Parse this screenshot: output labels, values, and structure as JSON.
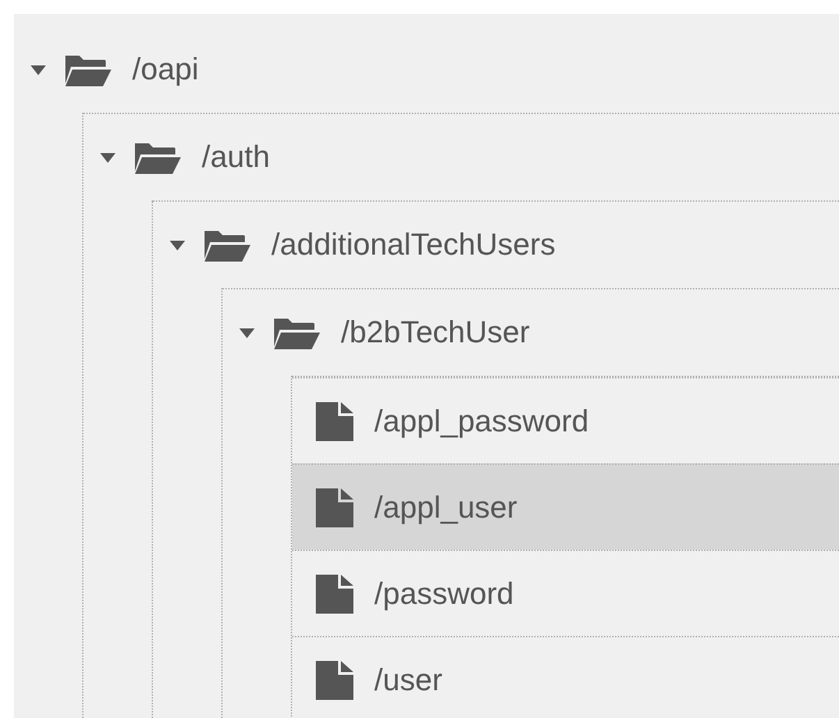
{
  "tree": [
    {
      "kind": "folder",
      "label": "/oapi",
      "expanded": true,
      "selected": false,
      "children": [
        {
          "kind": "folder",
          "label": "/auth",
          "expanded": true,
          "selected": false,
          "children": [
            {
              "kind": "folder",
              "label": "/additionalTechUsers",
              "expanded": true,
              "selected": false,
              "children": [
                {
                  "kind": "folder",
                  "label": "/b2bTechUser",
                  "expanded": true,
                  "selected": false,
                  "children": [
                    {
                      "kind": "file",
                      "label": "/appl_password",
                      "selected": false
                    },
                    {
                      "kind": "file",
                      "label": "/appl_user",
                      "selected": true
                    },
                    {
                      "kind": "file",
                      "label": "/password",
                      "selected": false
                    },
                    {
                      "kind": "file",
                      "label": "/user",
                      "selected": false
                    }
                  ]
                }
              ]
            }
          ]
        }
      ]
    }
  ]
}
